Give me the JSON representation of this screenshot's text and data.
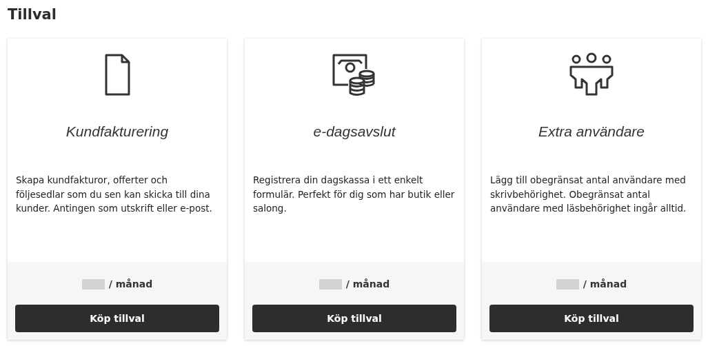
{
  "title": "Tillval",
  "cards": [
    {
      "name": "Kundfakturering",
      "description": "Skapa kundfakturor, offerter och följesedlar som du sen kan skicka till dina kunder. Antingen som utskrift eller e-post.",
      "price_unit": "/ månad",
      "button": "Köp tillval"
    },
    {
      "name": "e-dagsavslut",
      "description": "Registrera din dagskassa i ett enkelt formulär. Perfekt för dig som har butik eller salong.",
      "price_unit": "/ månad",
      "button": "Köp tillval"
    },
    {
      "name": "Extra användare",
      "description": "Lägg till obegränsat antal användare med skrivbehörighet. Obegränsat antal användare med läsbehörighet ingår alltid.",
      "price_unit": "/ månad",
      "button": "Köp tillval"
    }
  ]
}
